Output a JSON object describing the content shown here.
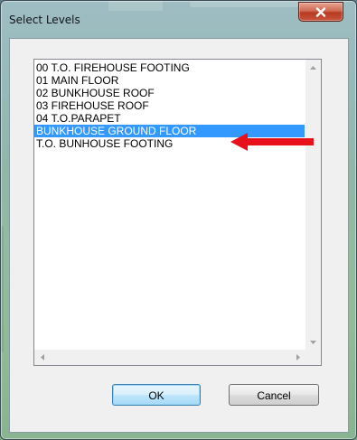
{
  "window": {
    "title": "Select Levels"
  },
  "levels": {
    "items": [
      "00 T.O. FIREHOUSE FOOTING",
      "01 MAIN  FLOOR",
      "02 BUNKHOUSE ROOF",
      "03 FIREHOUSE ROOF",
      "04  T.O.PARAPET",
      "BUNKHOUSE GROUND FLOOR",
      "T.O. BUNHOUSE FOOTING"
    ],
    "selected": "BUNKHOUSE GROUND FLOOR"
  },
  "buttons": {
    "ok": "OK",
    "cancel": "Cancel"
  },
  "colors": {
    "selection": "#3399ff",
    "annotation_arrow": "#e8101a"
  },
  "icons": {
    "close": "close-icon",
    "scroll_up": "scroll-up-arrow-icon",
    "scroll_down": "scroll-down-arrow-icon",
    "scroll_left": "scroll-left-arrow-icon",
    "scroll_right": "scroll-right-arrow-icon",
    "annotation": "red-arrow-icon"
  }
}
